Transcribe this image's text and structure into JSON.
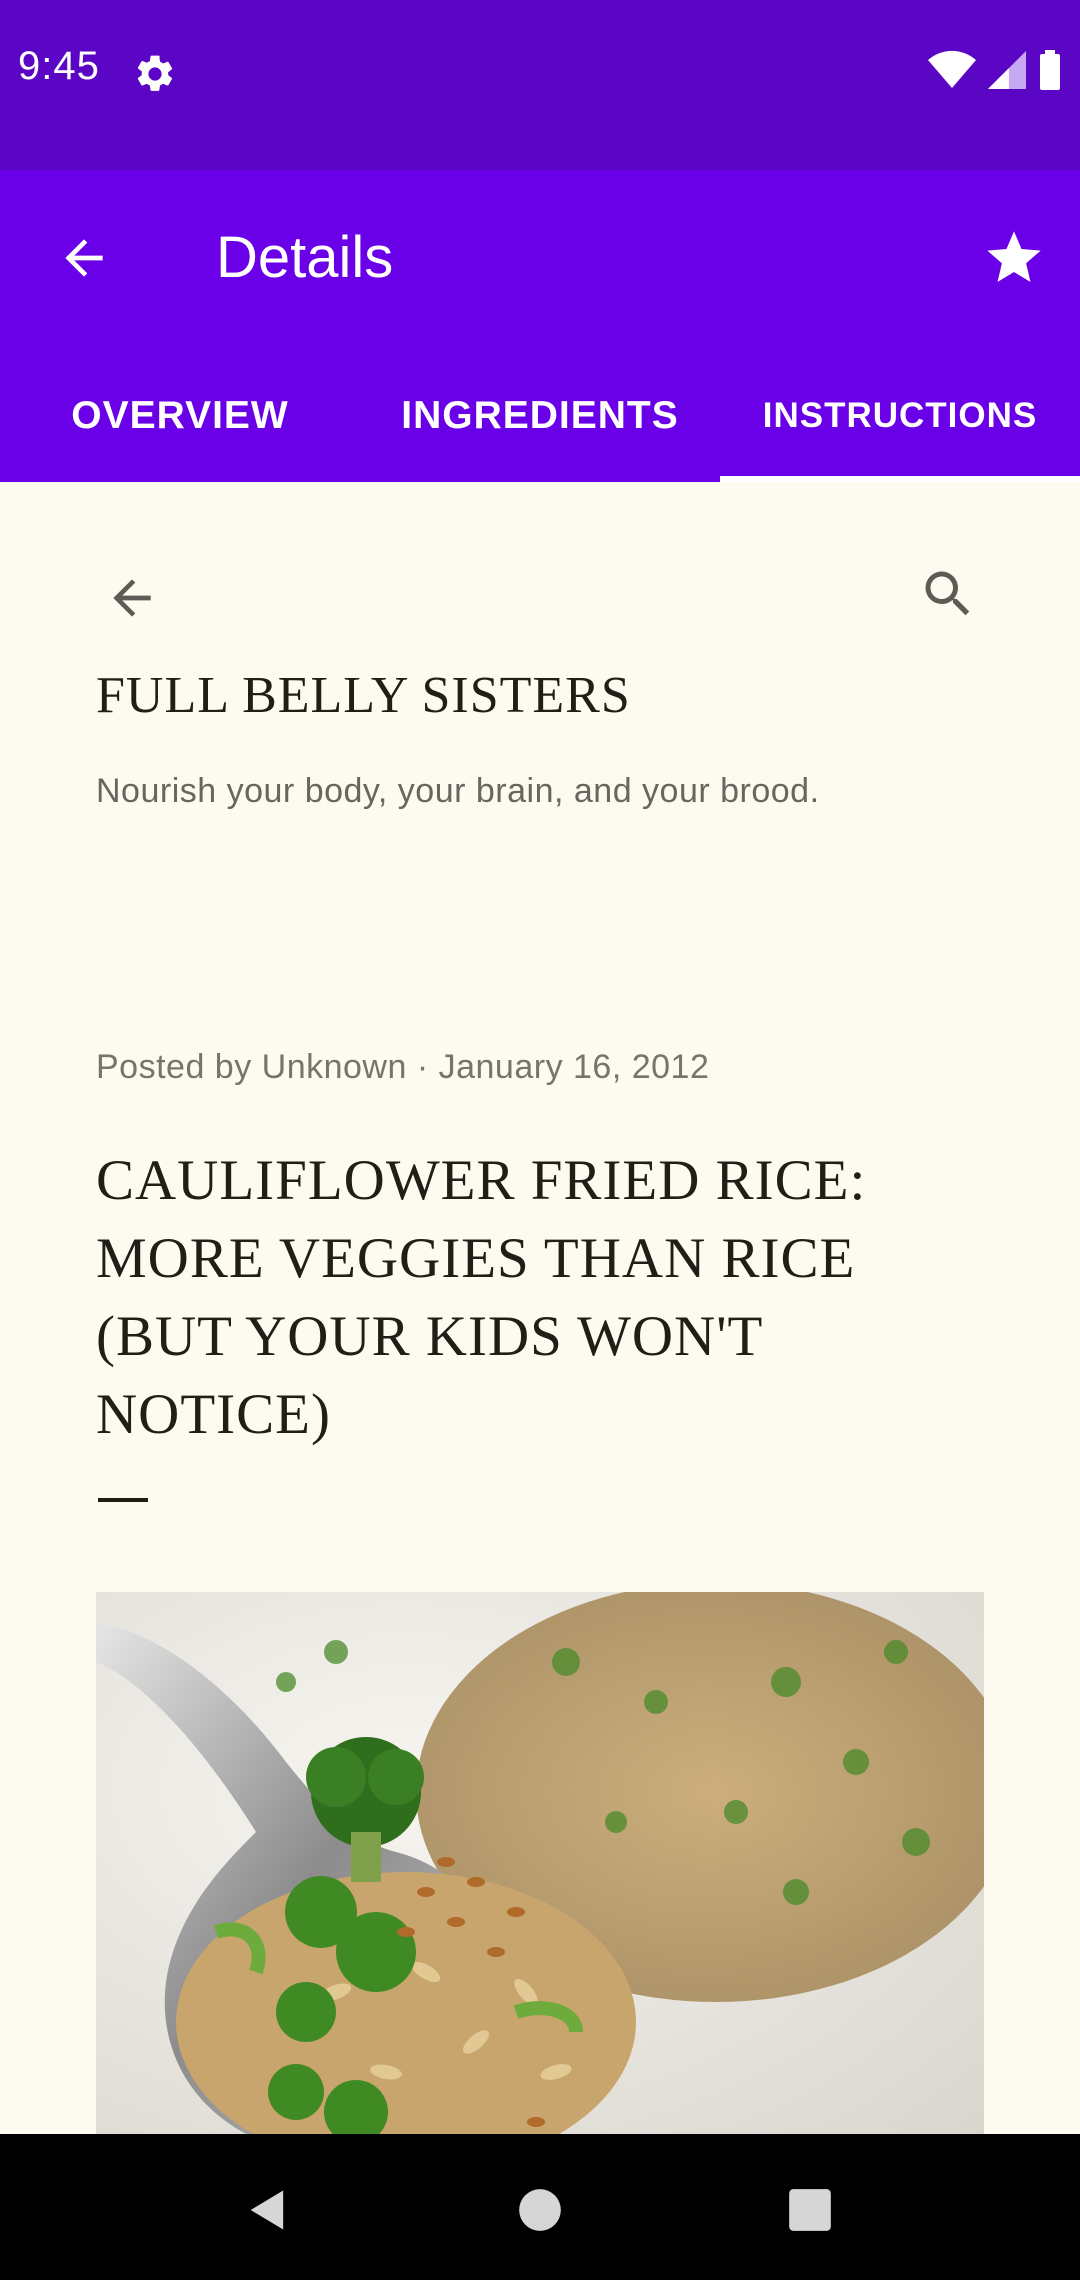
{
  "status_bar": {
    "time": "9:45",
    "icons": [
      "settings-gear-icon",
      "wifi-icon",
      "cellular-signal-icon",
      "battery-icon"
    ]
  },
  "app_bar": {
    "title": "Details",
    "back_icon": "arrow-back-icon",
    "favorite_icon": "star-icon",
    "tabs": [
      {
        "label": "OVERVIEW",
        "active": false
      },
      {
        "label": "INGREDIENTS",
        "active": false
      },
      {
        "label": "INSTRUCTIONS",
        "active": true
      }
    ]
  },
  "web": {
    "back_icon": "arrow-back-icon",
    "search_icon": "search-icon",
    "blog_title": "FULL BELLY SISTERS",
    "tagline": "Nourish your body, your brain, and your brood.",
    "post_meta": "Posted by Unknown · January 16, 2012",
    "post_title": "CAULIFLOWER FRIED RICE: MORE VEGGIES THAN RICE (BUT YOUR KIDS WON'T NOTICE)",
    "post_image": "fried-rice-photo"
  },
  "nav_bar": {
    "buttons": [
      "back-triangle-icon",
      "home-circle-icon",
      "recents-square-icon"
    ]
  },
  "colors": {
    "status_bar": "#5a06c4",
    "app_bar": "#6a00e8",
    "page_background": "#fdfbf0",
    "text_dark": "#231d18"
  }
}
